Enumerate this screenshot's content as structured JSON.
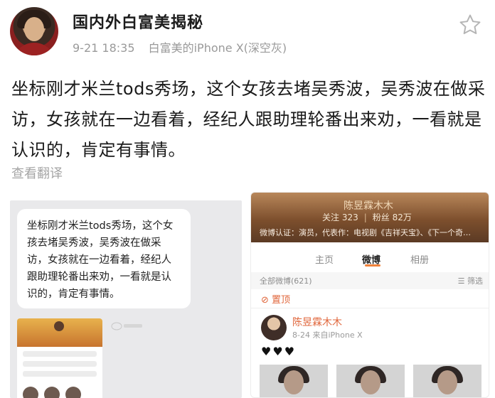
{
  "post": {
    "author_name": "国内外白富美揭秘",
    "time": "9-21 18:35",
    "source": "白富美的iPhone X(深空灰)",
    "text": "坐标刚才米兰tods秀场，这个女孩去堵吴秀波，吴秀波在做采访，女孩就在一边看着，经纪人跟助理轮番出来劝，一看就是认识的，肯定有事情。",
    "translate_label": "查看翻译",
    "star_icon": "star-outline-icon"
  },
  "embedded": {
    "bubble_text": "坐标刚才米兰tods秀场，这个女孩去堵吴秀波，吴秀波在做采访，女孩就在一边看着，经纪人跟助理轮番出来劝，一看就是认识的，肯定有事情。",
    "profile": {
      "banner_name": "陈昱霖木木",
      "stats": {
        "follow": "关注 323",
        "fans": "粉丝 82万"
      },
      "cert": "微博认证：演员，代表作：电视剧《吉祥天宝》、《下一个奇…",
      "tabs": [
        "主页",
        "微博",
        "相册"
      ],
      "active_tab": "微博",
      "all_count": "全部微博(621)",
      "filter": "筛选",
      "pinned": "置顶",
      "post_user": "陈昱霖木木",
      "post_meta": "8-24 来自iPhone X",
      "hearts": "♥♥♥"
    }
  },
  "colors": {
    "accent_orange": "#e0663b",
    "meta_gray": "#9a9a9a"
  }
}
